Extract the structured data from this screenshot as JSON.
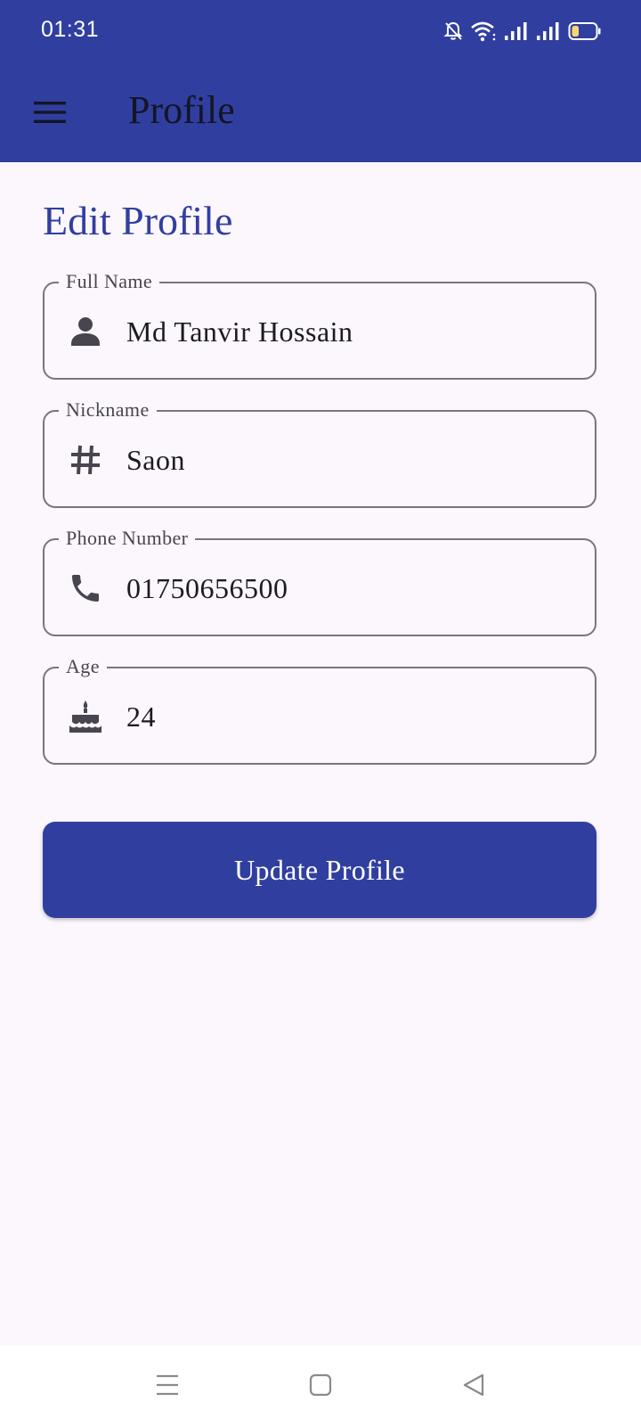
{
  "status_bar": {
    "time": "01:31",
    "icons": [
      "bell-off-icon",
      "wifi-icon",
      "signal-icon",
      "signal-icon",
      "battery-icon"
    ],
    "battery_level": 0.3,
    "battery_color": "#f5d76e"
  },
  "app_bar": {
    "title": "Profile",
    "menu_icon": "hamburger-menu-icon",
    "color": "#303f9f"
  },
  "page": {
    "heading": "Edit Profile",
    "background": "#fcf6fd"
  },
  "form": {
    "fields": [
      {
        "label": "Full Name",
        "value": "Md Tanvir Hossain",
        "icon": "person-icon"
      },
      {
        "label": "Nickname",
        "value": "Saon",
        "icon": "hashtag-icon"
      },
      {
        "label": "Phone Number",
        "value": "01750656500",
        "icon": "phone-icon"
      },
      {
        "label": "Age",
        "value": "24",
        "icon": "cake-icon"
      }
    ],
    "submit_label": "Update Profile"
  },
  "nav_bar": {
    "icons": [
      "recent-apps-icon",
      "home-icon",
      "back-icon"
    ]
  }
}
